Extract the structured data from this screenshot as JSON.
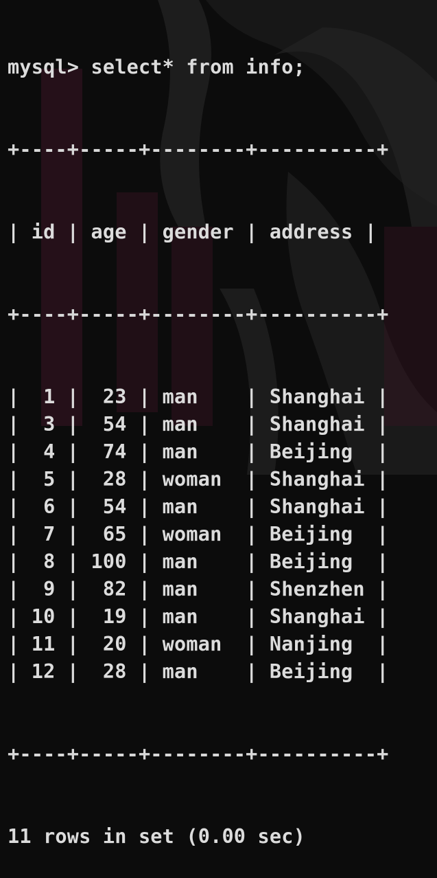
{
  "terminal": {
    "prompt": "mysql>",
    "command": "select* from info;",
    "footer": "11 rows in set (0.00 sec)"
  },
  "table": {
    "columns": [
      "id",
      "age",
      "gender",
      "address"
    ],
    "rows": [
      [
        "1",
        "23",
        "man",
        "Shanghai"
      ],
      [
        "3",
        "54",
        "man",
        "Shanghai"
      ],
      [
        "4",
        "74",
        "man",
        "Beijing"
      ],
      [
        "5",
        "28",
        "woman",
        "Shanghai"
      ],
      [
        "6",
        "54",
        "man",
        "Shanghai"
      ],
      [
        "7",
        "65",
        "woman",
        "Beijing"
      ],
      [
        "8",
        "100",
        "man",
        "Beijing"
      ],
      [
        "9",
        "82",
        "man",
        "Shenzhen"
      ],
      [
        "10",
        "19",
        "man",
        "Shanghai"
      ],
      [
        "11",
        "20",
        "woman",
        "Nanjing"
      ],
      [
        "12",
        "28",
        "man",
        "Beijing"
      ]
    ]
  },
  "colors": {
    "background": "#0c0c0c",
    "text": "#dcdcdc",
    "art_accent": "#5a1e32"
  }
}
